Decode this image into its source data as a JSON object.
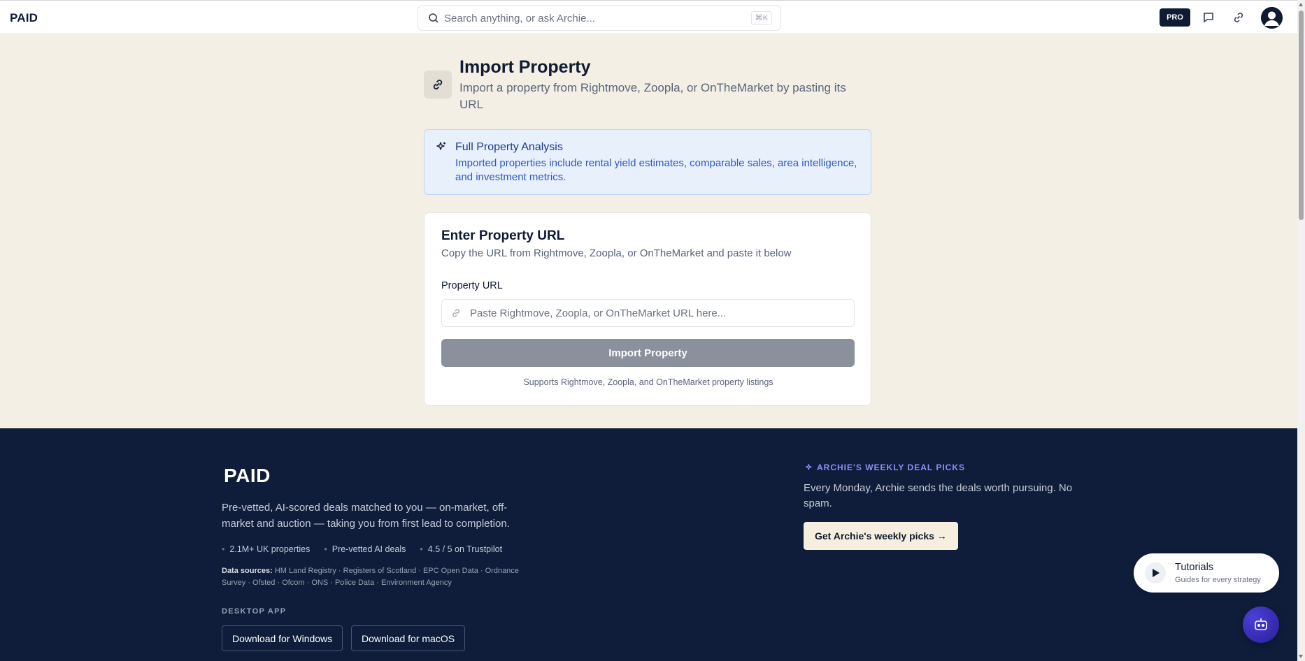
{
  "header": {
    "logo": "PAID",
    "search_placeholder": "Search anything, or ask Archie...",
    "search_shortcut": "⌘K",
    "pro_badge": "PRO"
  },
  "page": {
    "title": "Import Property",
    "subtitle": "Import a property from Rightmove, Zoopla, or OnTheMarket by pasting its URL"
  },
  "info_card": {
    "title": "Full Property Analysis",
    "description": "Imported properties include rental yield estimates, comparable sales, area intelligence, and investment metrics."
  },
  "form": {
    "title": "Enter Property URL",
    "description": "Copy the URL from Rightmove, Zoopla, or OnTheMarket and paste it below",
    "label": "Property URL",
    "input_value": "",
    "input_placeholder": "Paste Rightmove, Zoopla, or OnTheMarket URL here...",
    "button": "Import Property",
    "footnote": "Supports Rightmove, Zoopla, and OnTheMarket property listings"
  },
  "footer": {
    "logo": "PAID",
    "tagline": "Pre-vetted, AI-scored deals matched to you — on-market, off-market and auction — taking you from first lead to completion.",
    "stats": [
      "2.1M+ UK properties",
      "Pre-vetted AI deals",
      "4.5 / 5 on Trustpilot"
    ],
    "sources_label": "Data sources:",
    "sources": "HM Land Registry · Registers of Scotland · EPC Open Data · Ordnance Survey · Ofsted · Ofcom · ONS · Police Data · Environment Agency",
    "desktop_heading": "DESKTOP APP",
    "download_windows": "Download for Windows",
    "download_macos": "Download for macOS",
    "weekly_heading": "ARCHIE'S WEEKLY DEAL PICKS",
    "weekly_desc": "Every Monday, Archie sends the deals worth pursuing. No spam.",
    "weekly_button": "Get Archie's weekly picks →"
  },
  "tutorials": {
    "title": "Tutorials",
    "subtitle": "Guides for every strategy"
  },
  "colors": {
    "navy": "#0f1b33",
    "page_bg": "#f3efe4",
    "info_bg": "#e8f0fc",
    "info_text": "#2f57c8",
    "disabled_button": "#8b909d",
    "accent_purple": "#8f8ffb"
  },
  "icons": [
    "search-icon",
    "chat-icon",
    "link-icon",
    "user-avatar-icon",
    "sparkle-icon",
    "play-icon",
    "bot-icon"
  ]
}
